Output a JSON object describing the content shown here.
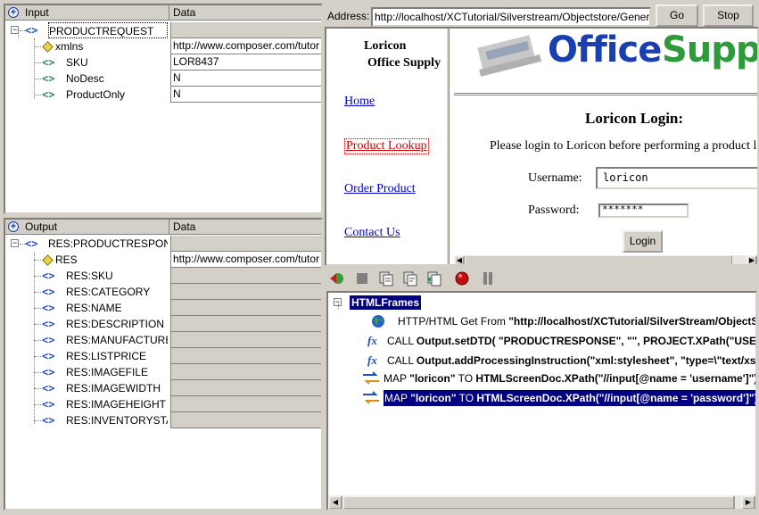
{
  "input_panel": {
    "col_name": "Input",
    "col_data": "Data",
    "rows": [
      {
        "label": "PRODUCTREQUEST",
        "value": "",
        "icon": "element-tag-icon"
      },
      {
        "label": "xmlns",
        "value": "http://www.composer.com/tutor",
        "icon": "attribute-icon"
      },
      {
        "label": "SKU",
        "value": "LOR8437",
        "icon": "element-tag-icon"
      },
      {
        "label": "NoDesc",
        "value": "N",
        "icon": "element-tag-icon"
      },
      {
        "label": "ProductOnly",
        "value": "N",
        "icon": "element-tag-icon"
      }
    ]
  },
  "output_panel": {
    "col_name": "Output",
    "col_data": "Data",
    "rows": [
      {
        "label": "RES:PRODUCTRESPONSE",
        "value": ""
      },
      {
        "label": "RES",
        "value": "http://www.composer.com/tutor"
      },
      {
        "label": "RES:SKU",
        "value": ""
      },
      {
        "label": "RES:CATEGORY",
        "value": ""
      },
      {
        "label": "RES:NAME",
        "value": ""
      },
      {
        "label": "RES:DESCRIPTION",
        "value": ""
      },
      {
        "label": "RES:MANUFACTURER",
        "value": ""
      },
      {
        "label": "RES:LISTPRICE",
        "value": ""
      },
      {
        "label": "RES:IMAGEFILE",
        "value": ""
      },
      {
        "label": "RES:IMAGEWIDTH",
        "value": ""
      },
      {
        "label": "RES:IMAGEHEIGHT",
        "value": ""
      },
      {
        "label": "RES:INVENTORYSTATUS",
        "value": ""
      }
    ]
  },
  "address_bar": {
    "label": "Address:",
    "url": "http://localhost/XCTutorial/Silverstream/Objectstore/General/",
    "go_label": "Go",
    "stop_label": "Stop"
  },
  "browser": {
    "site_name_line1": "Loricon",
    "site_name_line2": "Office Supply",
    "logo_text_office": "Office",
    "logo_text_supply": "Supply",
    "nav": [
      "Home",
      "Product Lookup",
      "Order Product",
      "Contact Us"
    ],
    "login_title": "Loricon Login:",
    "login_prompt": "Please login to Loricon before performing a product lookup.",
    "username_label": "Username:",
    "username_value": "loricon",
    "password_label": "Password:",
    "password_value": "*******",
    "login_button": "Login"
  },
  "trace": {
    "root": "HTMLFrames",
    "lines": [
      {
        "icon": "globe-icon",
        "prefix": "HTTP/HTML Get From ",
        "bold": "\"http://localhost/XCTutorial/SilverStream/ObjectStore/General/\""
      },
      {
        "icon": "function-icon",
        "prefix": "CALL ",
        "bold": "Output.setDTD( \"PRODUCTRESPONSE\", \"\", PROJECT.XPath(\"USERCONFIG/DTD\"))"
      },
      {
        "icon": "function-icon",
        "prefix": "CALL ",
        "bold": "Output.addProcessingInstruction(\"xml:stylesheet\", \"type=\\\"text/xsl\\\"\")"
      },
      {
        "icon": "map-icon",
        "prefix": "MAP ",
        "bold": "\"loricon\"",
        "mid": " TO ",
        "bold2": "HTMLScreenDoc.XPath(\"//input[@name = 'username']\")."
      },
      {
        "icon": "map-icon",
        "prefix": "MAP ",
        "bold": "\"loricon\"",
        "mid": " TO ",
        "bold2": "HTMLScreenDoc.XPath(\"//input[@name = 'password']\")."
      }
    ]
  },
  "colors": {
    "selection": "#000080",
    "tag_green": "#2e8b57",
    "tag_blue": "#1f4fc0",
    "logo_blue": "#1a3fb0",
    "logo_green": "#2e9a3a"
  }
}
